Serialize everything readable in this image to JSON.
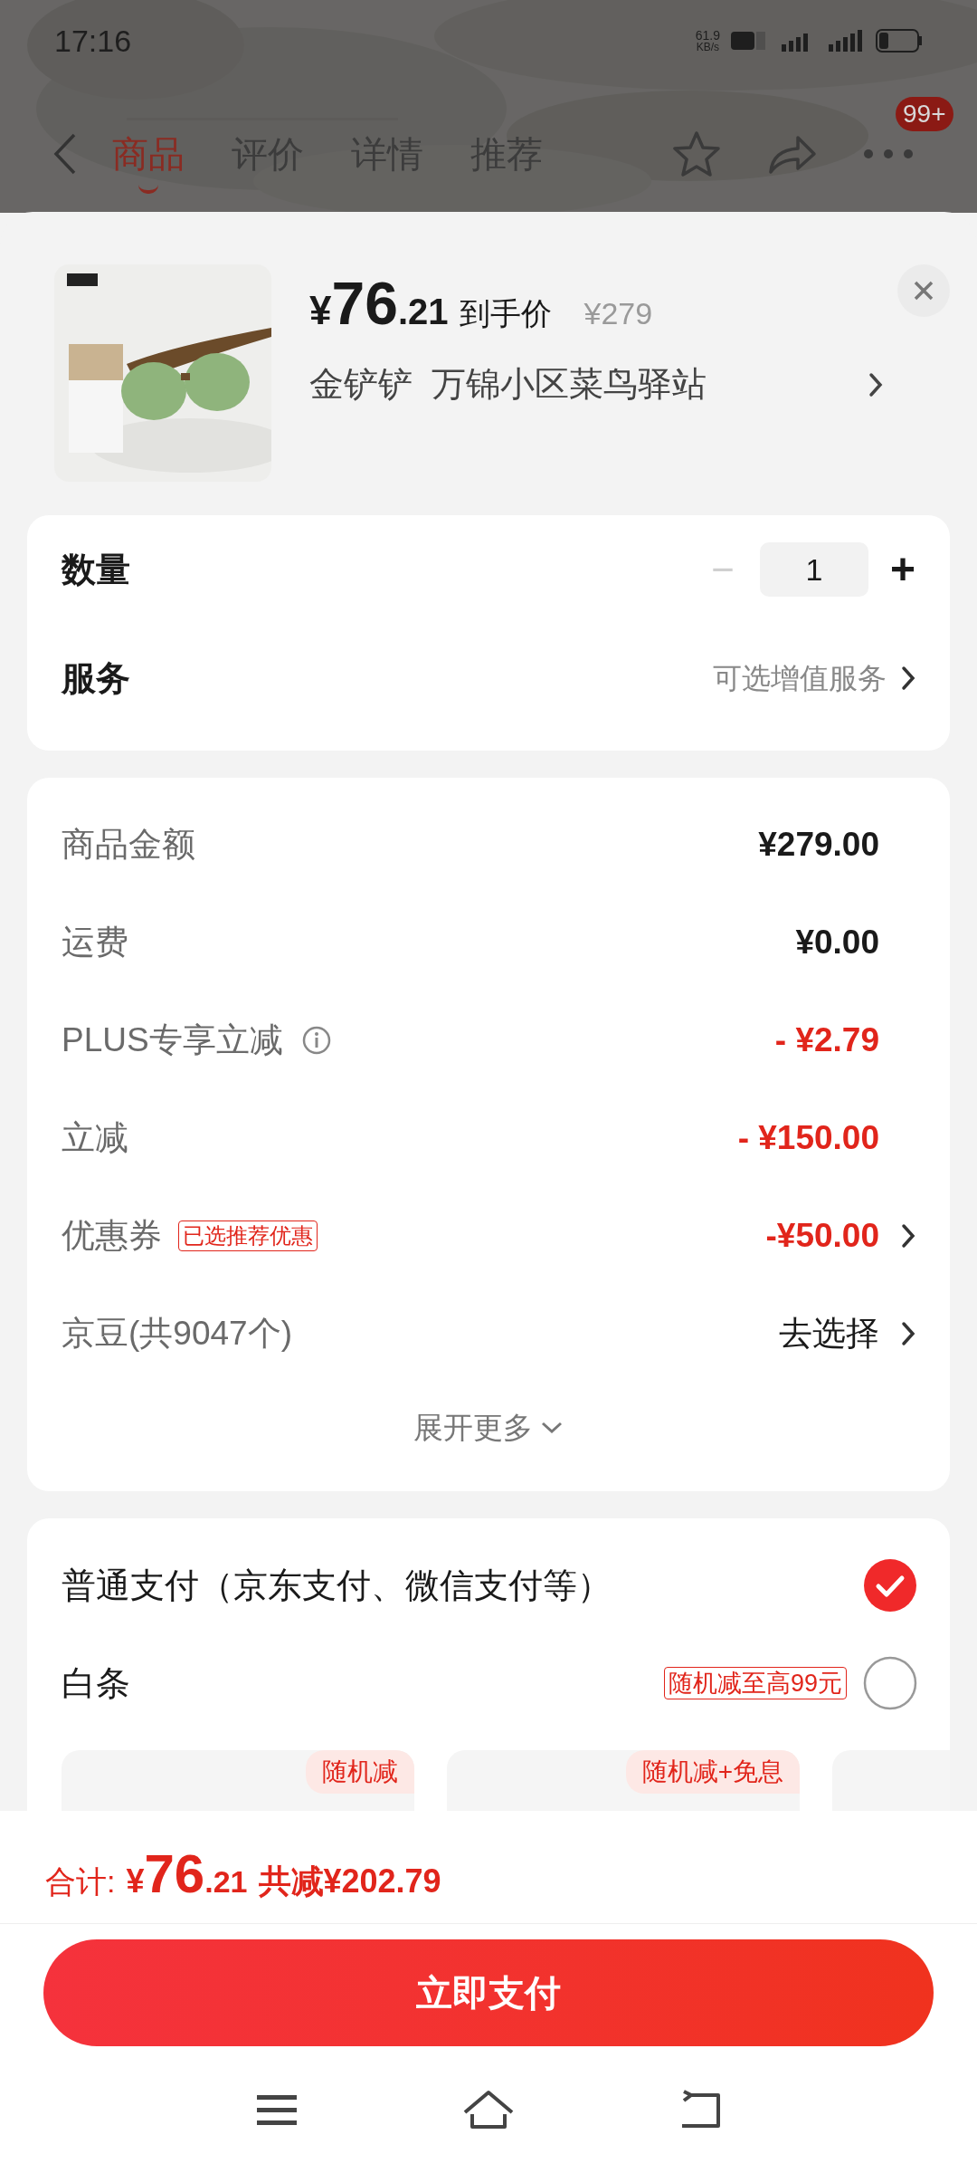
{
  "status_bar": {
    "time": "17:16",
    "speed": "61.9",
    "speed_unit": "KB/s"
  },
  "nav": {
    "tabs": [
      {
        "label": "商品",
        "selected": true
      },
      {
        "label": "评价",
        "selected": false
      },
      {
        "label": "详情",
        "selected": false
      },
      {
        "label": "推荐",
        "selected": false
      }
    ],
    "badge": "99+"
  },
  "product": {
    "currency": "¥",
    "price_int": "76",
    "price_dec": ".21",
    "price_label": "到手价",
    "original_price": "¥279",
    "address": "金铲铲  万锦小区菜鸟驿站"
  },
  "options": {
    "quantity_label": "数量",
    "quantity": "1",
    "minus": "−",
    "plus": "+",
    "service_label": "服务",
    "service_hint": "可选增值服务"
  },
  "summary": {
    "rows": [
      {
        "label": "商品金额",
        "value": "¥279.00",
        "kind": "plain"
      },
      {
        "label": "运费",
        "value": "¥0.00",
        "kind": "plain"
      },
      {
        "label": "PLUS专享立减",
        "value": "- ¥2.79",
        "kind": "info"
      },
      {
        "label": "立减",
        "value": "- ¥150.00",
        "kind": "discount"
      },
      {
        "label": "优惠券",
        "tag": "已选推荐优惠",
        "value": "-¥50.00",
        "kind": "coupon"
      },
      {
        "label": "京豆(共9047个)",
        "value": "去选择",
        "kind": "select"
      }
    ],
    "more": "展开更多"
  },
  "payment": {
    "methods": [
      {
        "label": "普通支付（京东支付、微信支付等）",
        "selected": true
      },
      {
        "label": "白条",
        "tag": "随机减至高99元",
        "selected": false
      }
    ],
    "plans": [
      {
        "kind": "badged",
        "badge": "随机减"
      },
      {
        "kind": "badged",
        "badge": "随机减+免息"
      },
      {
        "kind": "plain"
      }
    ]
  },
  "footer": {
    "total_label": "合计:",
    "currency": "¥",
    "total_int": "76",
    "total_dec": ".21",
    "saved": "共减¥202.79",
    "pay_button": "立即支付"
  }
}
